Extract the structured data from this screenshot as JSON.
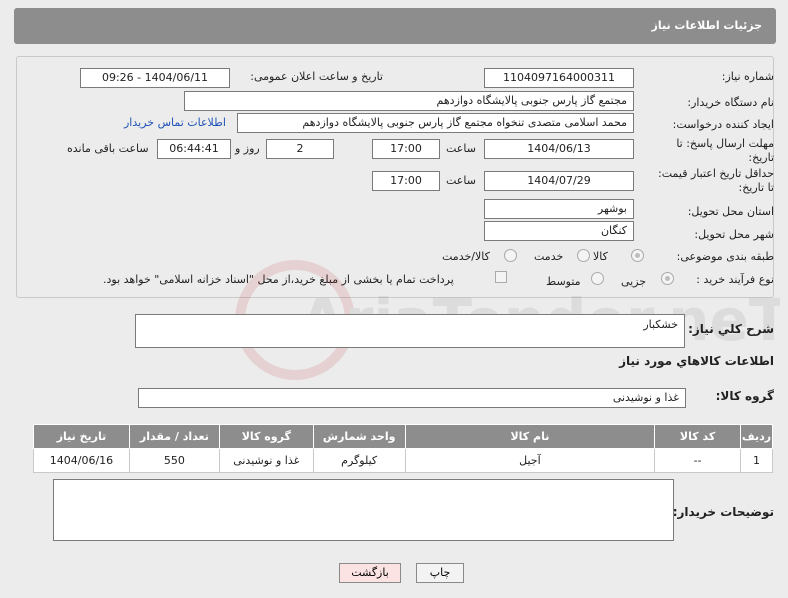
{
  "header": {
    "title": "جزئیات اطلاعات نیاز"
  },
  "form": {
    "need_number": {
      "label": "شماره نیاز:",
      "value": "1104097164000311"
    },
    "announce_datetime": {
      "label": "تاریخ و ساعت اعلان عمومی:",
      "value": "1404/06/11 - 09:26"
    },
    "buyer_org": {
      "label": "نام دستگاه خریدار:",
      "value": "مجتمع گاز پارس جنوبی  پالایشگاه دوازدهم"
    },
    "requester": {
      "label": "ایجاد کننده درخواست:",
      "value": "محمد اسلامی متصدی تنخواه مجتمع گاز پارس جنوبی  پالایشگاه دوازدهم",
      "link": "اطلاعات تماس خریدار"
    },
    "response_deadline": {
      "label_line1": "مهلت ارسال پاسخ: تا",
      "label_line2": "تاریخ:",
      "date": "1404/06/13",
      "time_label": "ساعت",
      "time": "17:00",
      "days": "2",
      "days_label": "روز و",
      "remaining": "06:44:41",
      "remaining_label": "ساعت باقی مانده"
    },
    "price_validity": {
      "label_line1": "حداقل تاریخ اعتبار قیمت:",
      "label_line2": "تا تاریخ:",
      "date": "1404/07/29",
      "time_label": "ساعت",
      "time": "17:00"
    },
    "delivery_province": {
      "label": "استان محل تحویل:",
      "value": "بوشهر"
    },
    "delivery_city": {
      "label": "شهر محل تحویل:",
      "value": "کنگان"
    },
    "category": {
      "label": "طبقه بندی موضوعی:",
      "options": [
        "کالا",
        "خدمت",
        "کالا/خدمت"
      ],
      "selected": "کالا"
    },
    "purchase_type": {
      "label": "نوع فرآیند خرید :",
      "options": [
        "جزیی",
        "متوسط"
      ],
      "selected": "جزیی",
      "note": "پرداخت تمام یا بخشی از مبلغ خرید،از محل \"اسناد خزانه اسلامی\" خواهد بود."
    }
  },
  "description": {
    "label": "شرح کلي نياز:",
    "value": "خشکبار"
  },
  "goods_section": {
    "title": "اطلاعات کالاهاي مورد نياز",
    "group_label": "گروه کالا:",
    "group_value": "غذا و نوشیدنی"
  },
  "table": {
    "headers": [
      "ردیف",
      "کد کالا",
      "نام کالا",
      "واحد شمارش",
      "گروه کالا",
      "تعداد / مقدار",
      "تاریخ نیاز"
    ],
    "rows": [
      [
        "1",
        "--",
        "آجیل",
        "کیلوگرم",
        "غذا و نوشیدنی",
        "550",
        "1404/06/16"
      ]
    ]
  },
  "buyer_notes": {
    "label": "توضیحات خریدار:",
    "value": ""
  },
  "buttons": {
    "print": "چاپ",
    "back": "بازگشت"
  },
  "watermark": {
    "text": "AriaTender.neT"
  }
}
